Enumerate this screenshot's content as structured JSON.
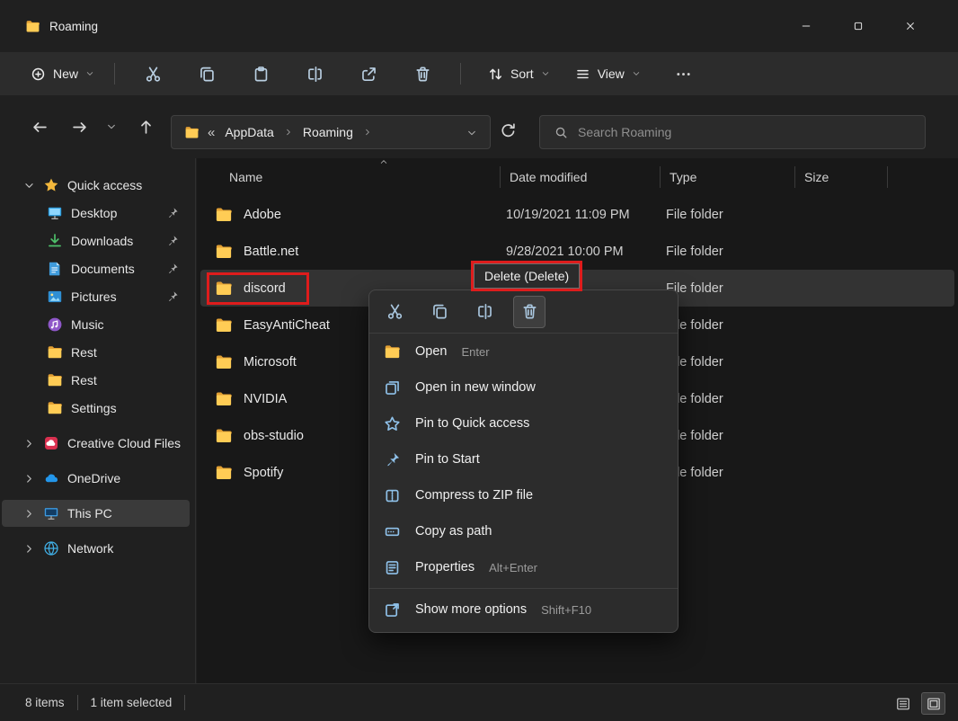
{
  "window": {
    "title": "Roaming"
  },
  "toolbar": {
    "new_label": "New",
    "sort_label": "Sort",
    "view_label": "View"
  },
  "nav": {
    "overflow": "«",
    "crumbs": [
      "AppData",
      "Roaming"
    ],
    "search_placeholder": "Search Roaming"
  },
  "sidebar": {
    "items": [
      {
        "label": "Quick access",
        "icon": "star",
        "expanded": true
      },
      {
        "label": "Desktop",
        "icon": "desktop",
        "child": true,
        "pinned": true
      },
      {
        "label": "Downloads",
        "icon": "downloads",
        "child": true,
        "pinned": true
      },
      {
        "label": "Documents",
        "icon": "documents",
        "child": true,
        "pinned": true
      },
      {
        "label": "Pictures",
        "icon": "pictures",
        "child": true,
        "pinned": true
      },
      {
        "label": "Music",
        "icon": "music",
        "child": true
      },
      {
        "label": "Rest",
        "icon": "folder",
        "child": true
      },
      {
        "label": "Rest",
        "icon": "folder",
        "child": true
      },
      {
        "label": "Settings",
        "icon": "folder",
        "child": true
      },
      {
        "label": "Creative Cloud Files",
        "icon": "creative-cloud",
        "collapsed": true,
        "group": true
      },
      {
        "label": "OneDrive",
        "icon": "onedrive",
        "collapsed": true,
        "group": true
      },
      {
        "label": "This PC",
        "icon": "this-pc",
        "collapsed": true,
        "group": true,
        "selected": true
      },
      {
        "label": "Network",
        "icon": "network",
        "collapsed": true,
        "group": true
      }
    ]
  },
  "files": {
    "columns": [
      "Name",
      "Date modified",
      "Type",
      "Size"
    ],
    "rows": [
      {
        "name": "Adobe",
        "date_modified": "10/19/2021 11:09 PM",
        "type": "File folder",
        "size": ""
      },
      {
        "name": "Battle.net",
        "date_modified": "9/28/2021 10:00 PM",
        "type": "File folder",
        "size": ""
      },
      {
        "name": "discord",
        "date_modified": "",
        "type": "File folder",
        "size": "",
        "selected": true
      },
      {
        "name": "EasyAntiCheat",
        "date_modified": "",
        "type": "File folder",
        "size": ""
      },
      {
        "name": "Microsoft",
        "date_modified": "",
        "type": "File folder",
        "size": ""
      },
      {
        "name": "NVIDIA",
        "date_modified": "",
        "type": "File folder",
        "size": ""
      },
      {
        "name": "obs-studio",
        "date_modified": "",
        "type": "File folder",
        "size": ""
      },
      {
        "name": "Spotify",
        "date_modified": "",
        "type": "File folder",
        "size": ""
      }
    ]
  },
  "context_menu": {
    "icon_actions": [
      {
        "name": "cut"
      },
      {
        "name": "copy"
      },
      {
        "name": "rename"
      },
      {
        "name": "delete",
        "highlighted": true
      }
    ],
    "items": [
      {
        "label": "Open",
        "shortcut": "Enter",
        "icon": "folder"
      },
      {
        "label": "Open in new window",
        "shortcut": "",
        "icon": "open-new-window"
      },
      {
        "label": "Pin to Quick access",
        "shortcut": "",
        "icon": "star-outline"
      },
      {
        "label": "Pin to Start",
        "shortcut": "",
        "icon": "pin"
      },
      {
        "label": "Compress to ZIP file",
        "shortcut": "",
        "icon": "zip"
      },
      {
        "label": "Copy as path",
        "shortcut": "",
        "icon": "copy-path"
      },
      {
        "label": "Properties",
        "shortcut": "Alt+Enter",
        "icon": "properties"
      },
      {
        "label": "Show more options",
        "shortcut": "Shift+F10",
        "icon": "show-more",
        "separator_before": true
      }
    ]
  },
  "tooltip": {
    "text": "Delete (Delete)"
  },
  "annotations": {
    "color": "#de1c1c"
  },
  "statusbar": {
    "item_count": "8 items",
    "selection": "1 item selected"
  }
}
